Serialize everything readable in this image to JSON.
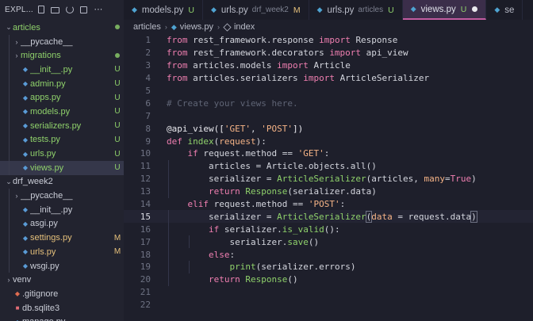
{
  "explorer": {
    "title": "EXPL...",
    "items": [
      {
        "name": "articles",
        "kind": "folder",
        "open": true,
        "level": 0,
        "status": "dot",
        "color": "green"
      },
      {
        "name": "__pycache__",
        "kind": "folder",
        "open": false,
        "level": 1,
        "status": "",
        "color": ""
      },
      {
        "name": "migrations",
        "kind": "folder",
        "open": false,
        "level": 1,
        "status": "dot",
        "color": "green"
      },
      {
        "name": "__init__.py",
        "kind": "py",
        "level": 1,
        "status": "U",
        "color": "green"
      },
      {
        "name": "admin.py",
        "kind": "py",
        "level": 1,
        "status": "U",
        "color": "green"
      },
      {
        "name": "apps.py",
        "kind": "py",
        "level": 1,
        "status": "U",
        "color": "green"
      },
      {
        "name": "models.py",
        "kind": "py",
        "level": 1,
        "status": "U",
        "color": "green"
      },
      {
        "name": "serializers.py",
        "kind": "py",
        "level": 1,
        "status": "U",
        "color": "green"
      },
      {
        "name": "tests.py",
        "kind": "py",
        "level": 1,
        "status": "U",
        "color": "green"
      },
      {
        "name": "urls.py",
        "kind": "py",
        "level": 1,
        "status": "U",
        "color": "green"
      },
      {
        "name": "views.py",
        "kind": "py",
        "level": 1,
        "status": "U",
        "color": "green",
        "selected": true
      },
      {
        "name": "drf_week2",
        "kind": "folder",
        "open": true,
        "level": 0,
        "status": "",
        "color": ""
      },
      {
        "name": "__pycache__",
        "kind": "folder",
        "open": false,
        "level": 1,
        "status": "",
        "color": ""
      },
      {
        "name": "__init__.py",
        "kind": "py",
        "level": 1,
        "status": "",
        "color": ""
      },
      {
        "name": "asgi.py",
        "kind": "py",
        "level": 1,
        "status": "",
        "color": ""
      },
      {
        "name": "settings.py",
        "kind": "py",
        "level": 1,
        "status": "M",
        "color": "yellow"
      },
      {
        "name": "urls.py",
        "kind": "py",
        "level": 1,
        "status": "M",
        "color": "yellow"
      },
      {
        "name": "wsgi.py",
        "kind": "py",
        "level": 1,
        "status": "",
        "color": ""
      },
      {
        "name": "venv",
        "kind": "folder",
        "open": false,
        "level": 0,
        "status": "",
        "color": ""
      },
      {
        "name": ".gitignore",
        "kind": "git",
        "level": 0,
        "status": "",
        "color": ""
      },
      {
        "name": "db.sqlite3",
        "kind": "db",
        "level": 0,
        "status": "",
        "color": ""
      },
      {
        "name": "manage.py",
        "kind": "py",
        "level": 0,
        "status": "",
        "color": ""
      }
    ]
  },
  "tabs": [
    {
      "name": "models.py",
      "sub": "",
      "status": "U",
      "active": false
    },
    {
      "name": "urls.py",
      "sub": "drf_week2",
      "status": "M",
      "active": false
    },
    {
      "name": "urls.py",
      "sub": "articles",
      "status": "U",
      "active": false
    },
    {
      "name": "views.py",
      "sub": "",
      "status": "U",
      "active": true,
      "dirty": true
    },
    {
      "name": "se",
      "sub": "",
      "status": "",
      "active": false
    }
  ],
  "breadcrumb": {
    "folder": "articles",
    "file": "views.py",
    "symbol": "index"
  },
  "editor": {
    "current_line": 15,
    "lines": [
      [
        [
          "kw",
          "from "
        ],
        [
          "",
          "rest_framework.response "
        ],
        [
          "kw",
          "import "
        ],
        [
          "",
          "Response"
        ]
      ],
      [
        [
          "kw",
          "from "
        ],
        [
          "",
          "rest_framework.decorators "
        ],
        [
          "kw",
          "import "
        ],
        [
          "",
          "api_view"
        ]
      ],
      [
        [
          "kw",
          "from "
        ],
        [
          "",
          "articles.models "
        ],
        [
          "kw",
          "import "
        ],
        [
          "",
          "Article"
        ]
      ],
      [
        [
          "kw",
          "from "
        ],
        [
          "",
          "articles.serializers "
        ],
        [
          "kw",
          "import "
        ],
        [
          "",
          "ArticleSerializer"
        ]
      ],
      [],
      [
        [
          "cm",
          "# Create your views here."
        ]
      ],
      [],
      [
        [
          "dec",
          "@api_view(["
        ],
        [
          "str",
          "'GET'"
        ],
        [
          "",
          ", "
        ],
        [
          "str",
          "'POST'"
        ],
        [
          "dec",
          "])"
        ]
      ],
      [
        [
          "kw",
          "def "
        ],
        [
          "fn",
          "index"
        ],
        [
          "",
          "("
        ],
        [
          "param",
          "request"
        ],
        [
          "",
          "):"
        ]
      ],
      [
        [
          "ws",
          "    "
        ],
        [
          "kw",
          "if "
        ],
        [
          "",
          "request.method == "
        ],
        [
          "str",
          "'GET'"
        ],
        [
          "",
          ":"
        ]
      ],
      [
        [
          "ws",
          "        "
        ],
        [
          "",
          "articles = Article.objects.all()"
        ]
      ],
      [
        [
          "ws",
          "        "
        ],
        [
          "",
          "serializer = "
        ],
        [
          "fn",
          "ArticleSerializer"
        ],
        [
          "",
          "(articles, "
        ],
        [
          "param",
          "many"
        ],
        [
          "",
          "="
        ],
        [
          "const",
          "True"
        ],
        [
          "",
          ")"
        ]
      ],
      [
        [
          "ws",
          "        "
        ],
        [
          "kw",
          "return "
        ],
        [
          "fn",
          "Response"
        ],
        [
          "",
          "(serializer.data)"
        ]
      ],
      [
        [
          "ws",
          "    "
        ],
        [
          "kw",
          "elif "
        ],
        [
          "",
          "request.method == "
        ],
        [
          "str",
          "'POST'"
        ],
        [
          "",
          ":"
        ]
      ],
      [
        [
          "ws",
          "        "
        ],
        [
          "",
          "serializer = "
        ],
        [
          "fn",
          "ArticleSerializer"
        ],
        [
          "brk",
          "("
        ],
        [
          "param",
          "data"
        ],
        [
          "",
          " = request.data"
        ],
        [
          "brk",
          ")"
        ]
      ],
      [
        [
          "ws",
          "        "
        ],
        [
          "kw",
          "if "
        ],
        [
          "",
          "serializer."
        ],
        [
          "fn",
          "is_valid"
        ],
        [
          "",
          "():"
        ]
      ],
      [
        [
          "ws",
          "            "
        ],
        [
          "",
          "serializer."
        ],
        [
          "fn",
          "save"
        ],
        [
          "",
          "()"
        ]
      ],
      [
        [
          "ws",
          "        "
        ],
        [
          "kw",
          "else"
        ],
        [
          "",
          ":"
        ]
      ],
      [
        [
          "ws",
          "            "
        ],
        [
          "fn",
          "print"
        ],
        [
          "",
          "(serializer.errors)"
        ]
      ],
      [
        [
          "ws",
          "        "
        ],
        [
          "kw",
          "return "
        ],
        [
          "fn",
          "Response"
        ],
        [
          "",
          "()"
        ]
      ],
      [],
      []
    ]
  }
}
